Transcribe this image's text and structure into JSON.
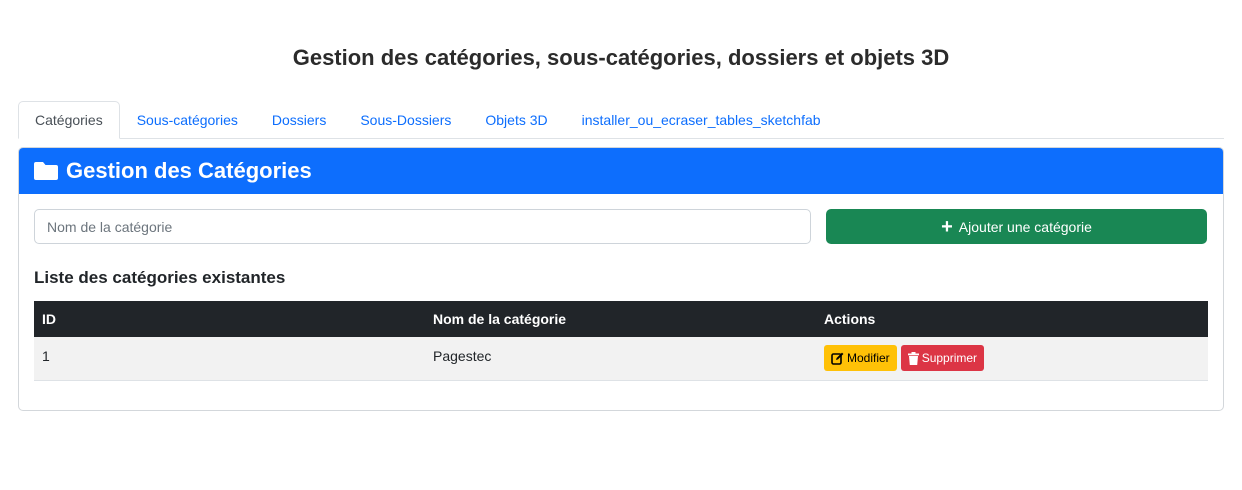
{
  "page": {
    "title": "Gestion des catégories, sous-catégories, dossiers et objets 3D"
  },
  "tabs": [
    {
      "label": "Catégories",
      "active": true
    },
    {
      "label": "Sous-catégories",
      "active": false
    },
    {
      "label": "Dossiers",
      "active": false
    },
    {
      "label": "Sous-Dossiers",
      "active": false
    },
    {
      "label": "Objets 3D",
      "active": false
    },
    {
      "label": "installer_ou_ecraser_tables_sketchfab",
      "active": false
    }
  ],
  "panel": {
    "header_icon": "folder-icon",
    "header_title": "Gestion des Catégories",
    "accent_color": "#0d6efd",
    "input": {
      "placeholder": "Nom de la catégorie",
      "value": ""
    },
    "add_button": {
      "icon": "plus-icon",
      "label": "Ajouter une catégorie",
      "color": "#198754"
    },
    "list_title": "Liste des catégories existantes",
    "table": {
      "columns": [
        "ID",
        "Nom de la catégorie",
        "Actions"
      ],
      "rows": [
        {
          "id": "1",
          "name": "Pagestec",
          "edit_label": "Modifier",
          "delete_label": "Supprimer"
        }
      ]
    },
    "edit_color": "#ffc107",
    "delete_color": "#dc3545"
  }
}
